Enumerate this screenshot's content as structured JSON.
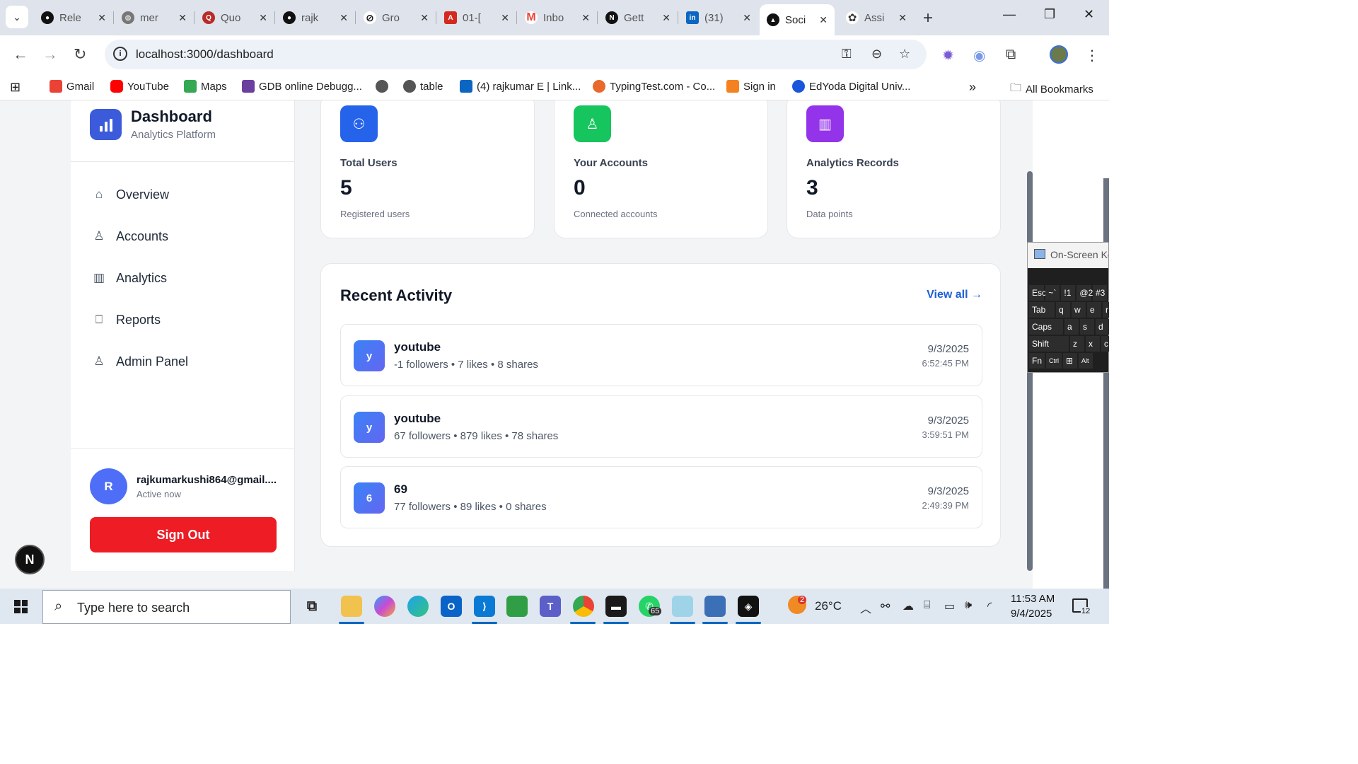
{
  "browser": {
    "tabs": [
      {
        "title": "Rele",
        "icon": "github-icon",
        "color": "#111111"
      },
      {
        "title": "mer",
        "icon": "globe-icon",
        "color": "#666666"
      },
      {
        "title": "Quo",
        "icon": "quora-icon",
        "color": "#b92b27"
      },
      {
        "title": "rajk",
        "icon": "github-icon",
        "color": "#111111"
      },
      {
        "title": "Gro",
        "icon": "grok-icon",
        "color": "#111111"
      },
      {
        "title": "01-[",
        "icon": "pdf-icon",
        "color": "#d4291f"
      },
      {
        "title": "Inbo",
        "icon": "gmail-icon",
        "color": "#ea4335"
      },
      {
        "title": "Gett",
        "icon": "nextjs-icon",
        "color": "#111111"
      },
      {
        "title": "(31)",
        "icon": "linkedin-icon",
        "color": "#0a66c2"
      },
      {
        "title": "Soci",
        "icon": "triangle-icon",
        "color": "#111111",
        "active": true
      },
      {
        "title": "Assi",
        "icon": "openai-icon",
        "color": "#333333"
      }
    ],
    "url": "localhost:3000/dashboard",
    "bookmarks": [
      {
        "label": "Gmail",
        "color": "#ea4335"
      },
      {
        "label": "YouTube",
        "color": "#ff0000"
      },
      {
        "label": "Maps",
        "color": "#34a853"
      },
      {
        "label": "GDB online Debugg...",
        "color": "#6b3fa0"
      },
      {
        "label": "",
        "color": "#555555"
      },
      {
        "label": "table",
        "color": "#555555"
      },
      {
        "label": "(4) rajkumar E | Link...",
        "color": "#0a66c2"
      },
      {
        "label": "TypingTest.com - Co...",
        "color": "#e8692b"
      },
      {
        "label": "Sign in",
        "color": "#f58220"
      },
      {
        "label": "EdYoda Digital Univ...",
        "color": "#1a56db"
      }
    ],
    "all_bookmarks": "All Bookmarks"
  },
  "sidebar": {
    "title": "Dashboard",
    "subtitle": "Analytics Platform",
    "items": [
      {
        "label": "Overview",
        "icon": "home-icon"
      },
      {
        "label": "Accounts",
        "icon": "user-icon"
      },
      {
        "label": "Analytics",
        "icon": "bar-chart-icon"
      },
      {
        "label": "Reports",
        "icon": "bookmark-icon"
      },
      {
        "label": "Admin Panel",
        "icon": "user-icon"
      }
    ],
    "user": {
      "initial": "R",
      "email": "rajkumarkushi864@gmail....",
      "status": "Active now"
    },
    "sign_out": "Sign Out"
  },
  "stats": [
    {
      "label": "Total Users",
      "value": "5",
      "sub": "Registered users",
      "color": "#2563eb",
      "icon": "users-icon"
    },
    {
      "label": "Your Accounts",
      "value": "0",
      "sub": "Connected accounts",
      "color": "#16c55e",
      "icon": "user-icon"
    },
    {
      "label": "Analytics Records",
      "value": "3",
      "sub": "Data points",
      "color": "#9333ea",
      "icon": "bar-chart-icon"
    }
  ],
  "activity": {
    "title": "Recent Activity",
    "view_all": "View all →",
    "rows": [
      {
        "badge": "y",
        "name": "youtube",
        "meta": "-1 followers • 7 likes • 8 shares",
        "date": "9/3/2025",
        "time": "6:52:45 PM"
      },
      {
        "badge": "y",
        "name": "youtube",
        "meta": "67 followers • 879 likes • 78 shares",
        "date": "9/3/2025",
        "time": "3:59:51 PM"
      },
      {
        "badge": "6",
        "name": "69",
        "meta": "77 followers • 89 likes • 0 shares",
        "date": "9/3/2025",
        "time": "2:49:39 PM"
      }
    ]
  },
  "next_badge": "N",
  "osk": {
    "title": "On-Screen Keyboard",
    "rows": [
      [
        "Esc",
        "~`",
        "!1",
        "@2",
        "#3"
      ],
      [
        "Tab",
        "q",
        "w",
        "e",
        "r"
      ],
      [
        "Caps",
        "a",
        "s",
        "d"
      ],
      [
        "Shift",
        "z",
        "x",
        "c"
      ],
      [
        "Fn",
        "Ctrl",
        "⊞",
        "Alt"
      ]
    ]
  },
  "taskbar": {
    "search_placeholder": "Type here to search",
    "weather": "26°C",
    "weather_badge": "2",
    "whatsapp_badge": "65",
    "time": "11:53 AM",
    "date": "9/4/2025",
    "notifications": "12"
  }
}
